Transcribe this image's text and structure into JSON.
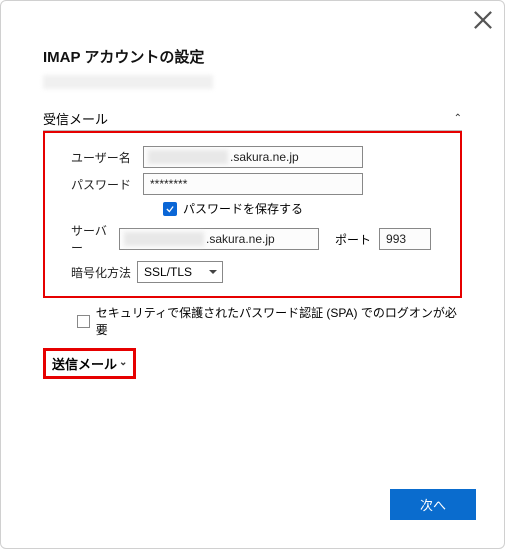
{
  "title": "IMAP アカウントの設定",
  "incoming": {
    "header": "受信メール",
    "user_label": "ユーザー名",
    "user_value": ".sakura.ne.jp",
    "pass_label": "パスワード",
    "pass_value": "********",
    "save_pass_label": "パスワードを保存する",
    "server_label": "サーバー",
    "server_value": ".sakura.ne.jp",
    "port_label": "ポート",
    "port_value": "993",
    "enc_label": "暗号化方法",
    "enc_value": "SSL/TLS",
    "spa_label": "セキュリティで保護されたパスワード認証 (SPA) でのログオンが必要"
  },
  "outgoing": {
    "header": "送信メール"
  },
  "buttons": {
    "next": "次へ"
  }
}
